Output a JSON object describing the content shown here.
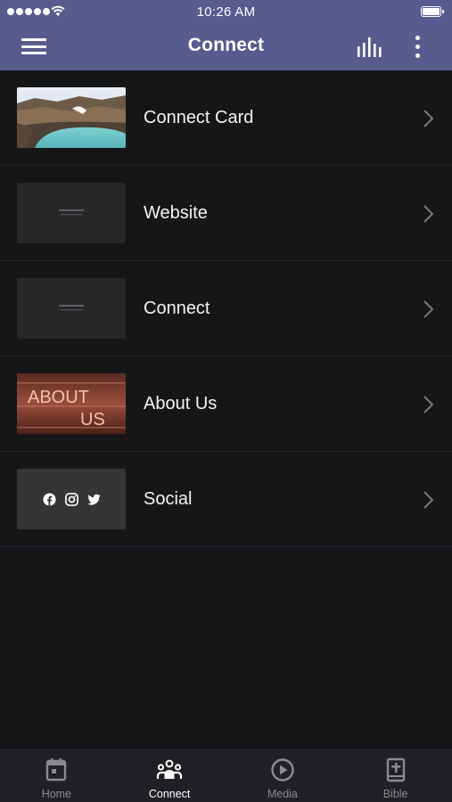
{
  "status_bar": {
    "time": "10:26 AM"
  },
  "nav": {
    "title": "Connect",
    "menu_icon": "hamburger-menu-icon",
    "audio_icon": "audio-bars-icon",
    "more_icon": "vertical-ellipsis-icon"
  },
  "list": {
    "items": [
      {
        "label": "Connect Card",
        "thumbnail": "landscape-lake-photo"
      },
      {
        "label": "Website",
        "thumbnail": "dark-placeholder"
      },
      {
        "label": "Connect",
        "thumbnail": "dark-placeholder"
      },
      {
        "label": "About Us",
        "thumbnail": "about-us-graphic",
        "thumbnail_text_1": "ABOUT",
        "thumbnail_text_2": "US"
      },
      {
        "label": "Social",
        "thumbnail": "social-icons-graphic",
        "thumbnail_icons": [
          "facebook-icon",
          "instagram-icon",
          "twitter-icon"
        ]
      }
    ]
  },
  "tab_bar": {
    "tabs": [
      {
        "label": "Home",
        "icon": "calendar-icon",
        "active": false
      },
      {
        "label": "Connect",
        "icon": "people-group-icon",
        "active": true
      },
      {
        "label": "Media",
        "icon": "play-circle-icon",
        "active": false
      },
      {
        "label": "Bible",
        "icon": "bible-book-icon",
        "active": false
      }
    ]
  },
  "colors": {
    "header_background": "#575b8e",
    "page_background": "#151618",
    "tab_bar_background": "#202124",
    "inactive_tab_text": "#8a8b8f",
    "active_tab_text": "#ffffff"
  }
}
